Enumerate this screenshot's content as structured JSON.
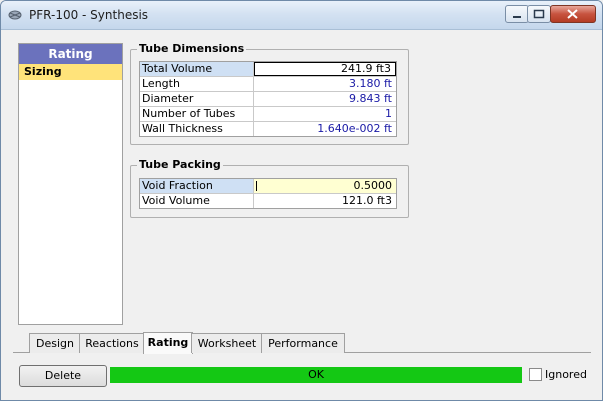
{
  "window": {
    "title": "PFR-100 - Synthesis"
  },
  "left_nav": {
    "header": "Rating",
    "items": [
      {
        "label": "Sizing",
        "selected": true
      }
    ]
  },
  "tube_dimensions": {
    "title": "Tube Dimensions",
    "rows": [
      {
        "label": "Total Volume",
        "value": "241.9 ft3"
      },
      {
        "label": "Length",
        "value": "3.180 ft"
      },
      {
        "label": "Diameter",
        "value": "9.843 ft"
      },
      {
        "label": "Number of Tubes",
        "value": "1"
      },
      {
        "label": "Wall Thickness",
        "value": "1.640e-002 ft"
      }
    ]
  },
  "tube_packing": {
    "title": "Tube Packing",
    "rows": [
      {
        "label": "Void Fraction",
        "value": "0.5000"
      },
      {
        "label": "Void Volume",
        "value": "121.0 ft3"
      }
    ]
  },
  "tabs": [
    {
      "label": "Design"
    },
    {
      "label": "Reactions"
    },
    {
      "label": "Rating",
      "active": true
    },
    {
      "label": "Worksheet"
    },
    {
      "label": "Performance"
    }
  ],
  "footer": {
    "delete_label": "Delete",
    "status_text": "OK",
    "status_color": "#14c814",
    "ignored_label": "Ignored",
    "ignored_checked": false
  },
  "colors": {
    "nav_header": "#6b72bd",
    "nav_selected": "#ffe37a",
    "value_text": "#1a1aa6",
    "edit_cell": "#ffffd2"
  }
}
